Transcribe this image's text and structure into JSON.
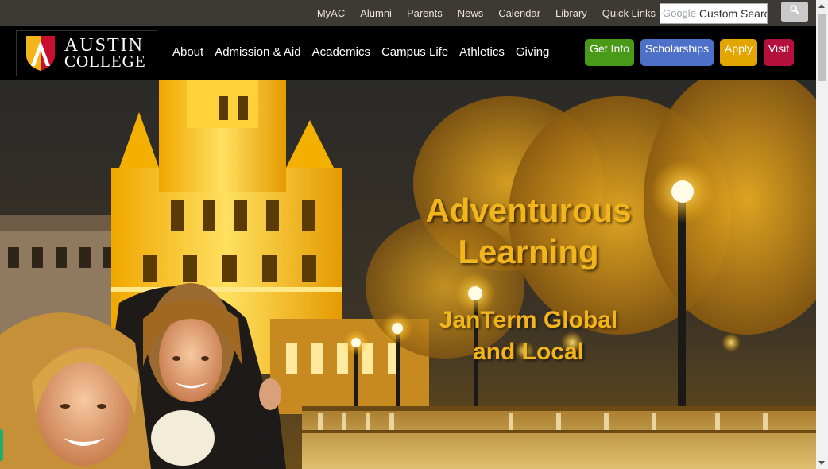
{
  "utility_nav": {
    "links": [
      "MyAC",
      "Alumni",
      "Parents",
      "News",
      "Calendar",
      "Library",
      "Quick Links"
    ],
    "search": {
      "brand_mark": "Google",
      "placeholder": "Custom Search",
      "value": "Custom Searc",
      "button_icon": "search-icon"
    }
  },
  "brand": {
    "line1": "AUSTIN",
    "line2": "COLLEGE",
    "colors": {
      "shield_gold": "#f2b51c",
      "shield_red": "#c8102e"
    }
  },
  "main_nav": {
    "items": [
      "About",
      "Admission & Aid",
      "Academics",
      "Campus Life",
      "Athletics",
      "Giving"
    ]
  },
  "cta_buttons": {
    "get_info": {
      "label": "Get Info",
      "color": "#4a9a19"
    },
    "scholarships": {
      "label": "Scholarships",
      "color": "#4d71c9"
    },
    "apply": {
      "label": "Apply",
      "color": "#e3a600"
    },
    "visit": {
      "label": "Visit",
      "color": "#b5103c"
    }
  },
  "hero": {
    "title_line1": "Adventurous",
    "title_line2": "Learning",
    "subtitle_line1": "JanTerm Global",
    "subtitle_line2": "and Local",
    "text_color": "#f2b51c"
  }
}
